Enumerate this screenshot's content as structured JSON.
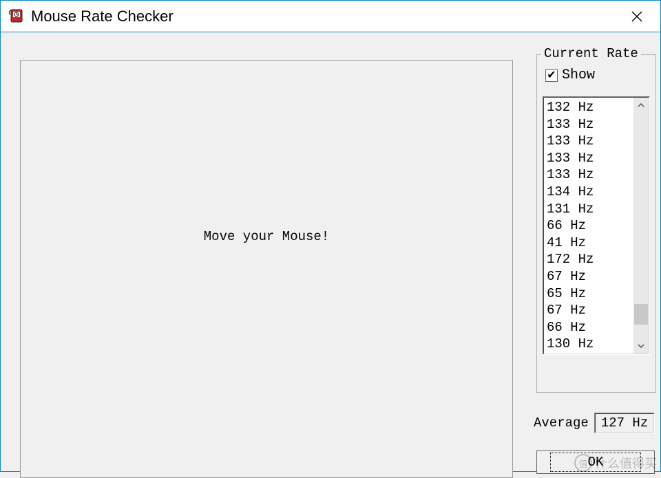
{
  "window": {
    "title": "Mouse Rate Checker"
  },
  "main": {
    "message": "Move your Mouse!"
  },
  "currentRate": {
    "legend": "Current Rate",
    "show_label": "Show",
    "show_checked": true,
    "items": [
      "132 Hz",
      "133 Hz",
      "133 Hz",
      "133 Hz",
      "133 Hz",
      "134 Hz",
      "131 Hz",
      "66 Hz",
      "41 Hz",
      "172 Hz",
      "67 Hz",
      "65 Hz",
      "67 Hz",
      "66 Hz",
      "130 Hz"
    ]
  },
  "average": {
    "label": "Average",
    "value": "127 Hz"
  },
  "buttons": {
    "ok": "OK"
  },
  "watermark": {
    "badge": "值",
    "text": "什么值得买"
  }
}
